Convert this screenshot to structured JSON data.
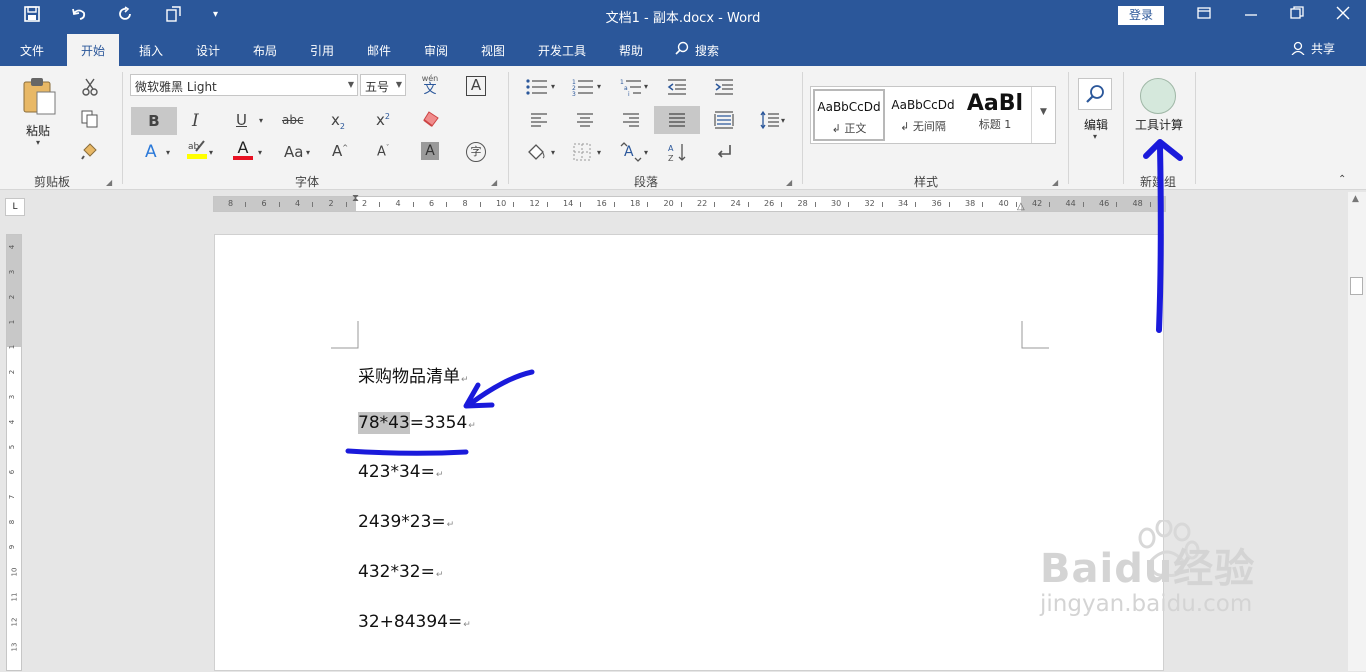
{
  "titlebar": {
    "title": "文档1 - 副本.docx  -  Word",
    "login": "登录",
    "icons": [
      "save-icon",
      "undo-icon",
      "redo-icon",
      "touch-mode-icon",
      "customize-quick-access-icon"
    ]
  },
  "tabs": [
    {
      "label": "文件"
    },
    {
      "label": "开始"
    },
    {
      "label": "插入"
    },
    {
      "label": "设计"
    },
    {
      "label": "布局"
    },
    {
      "label": "引用"
    },
    {
      "label": "邮件"
    },
    {
      "label": "审阅"
    },
    {
      "label": "视图"
    },
    {
      "label": "开发工具"
    },
    {
      "label": "帮助"
    },
    {
      "label": "搜索"
    }
  ],
  "share": "共享",
  "ribbon": {
    "clipboard": {
      "paste": "粘贴",
      "label": "剪贴板"
    },
    "font": {
      "name": "微软雅黑 Light",
      "size": "五号",
      "label": "字体",
      "wen": "wén",
      "wen_char": "文",
      "aa": "Aa"
    },
    "paragraph": {
      "label": "段落"
    },
    "styles": {
      "label": "样式",
      "items": [
        {
          "preview": "AaBbCcDd",
          "name": "↲ 正文"
        },
        {
          "preview": "AaBbCcDd",
          "name": "↲ 无间隔"
        },
        {
          "preview": "AaBl",
          "name": "标题 1"
        }
      ]
    },
    "edit": {
      "label": "编辑"
    },
    "newgroup": {
      "button": "工具计算",
      "label": "新建组"
    }
  },
  "ruler_h_ticks": [
    "8",
    "6",
    "4",
    "2",
    "2",
    "4",
    "6",
    "8",
    "10",
    "12",
    "14",
    "16",
    "18",
    "20",
    "22",
    "24",
    "26",
    "28",
    "30",
    "32",
    "34",
    "36",
    "38",
    "40",
    "42",
    "44",
    "46",
    "48"
  ],
  "ruler_v_ticks": [
    "4",
    "3",
    "2",
    "1",
    "1",
    "2",
    "3",
    "4",
    "5",
    "6",
    "7",
    "8",
    "9",
    "10",
    "11",
    "12",
    "13"
  ],
  "document": {
    "lines": [
      {
        "text": "采购物品清单"
      },
      {
        "selected": "78*43",
        "text": "=3354"
      },
      {
        "text": "423*34="
      },
      {
        "text": "2439*23="
      },
      {
        "text": "432*32="
      },
      {
        "text": "32+84394="
      }
    ],
    "para_mark": "↵"
  },
  "watermark": {
    "line1": "Baidu经验",
    "line2": "jingyan.baidu.com"
  },
  "colors": {
    "accent": "#2b579a",
    "annotation": "#1a1adb",
    "highlight_yellow": "#ffff00",
    "font_red": "#e81123"
  }
}
